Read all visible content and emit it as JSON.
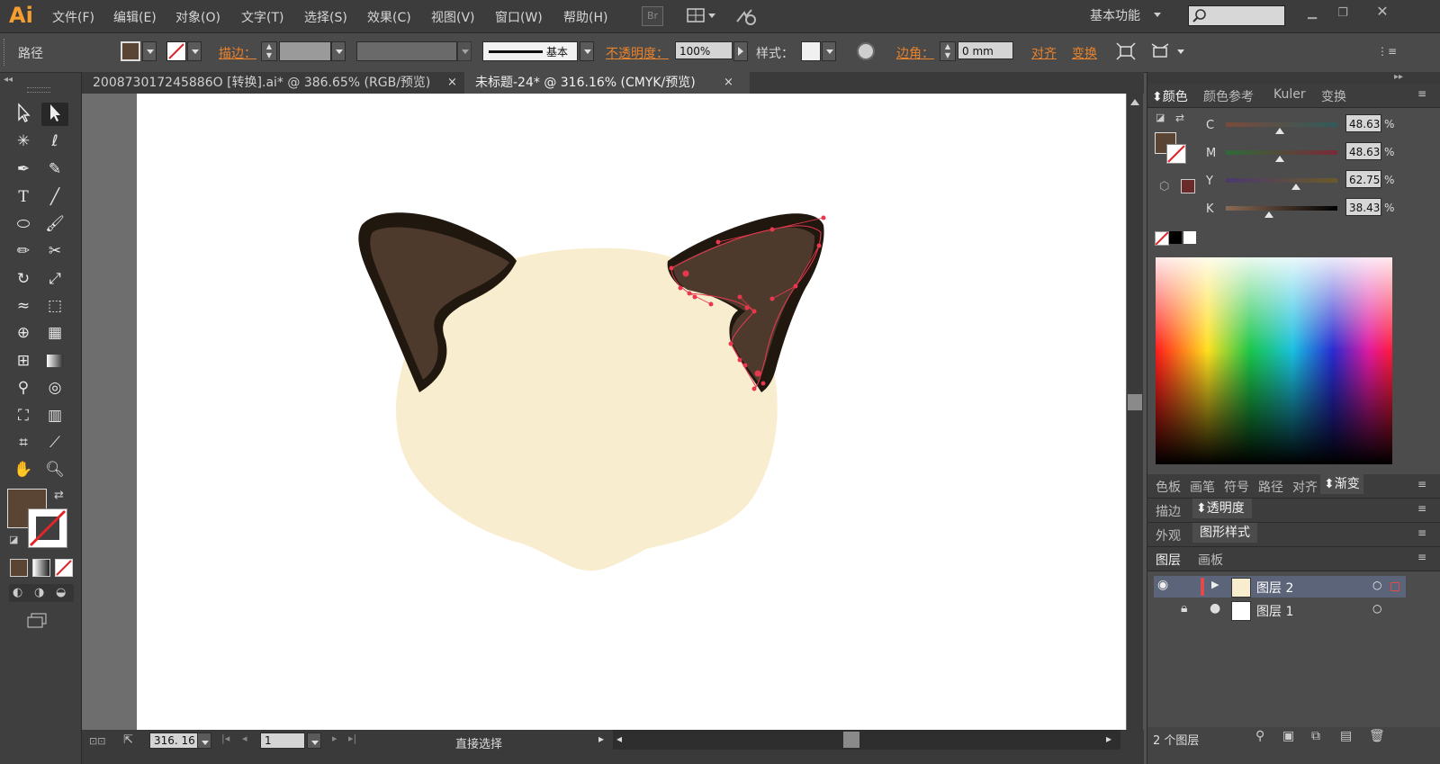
{
  "app": {
    "logo": "Ai",
    "workspace": "基本功能",
    "bridge_label": "Br"
  },
  "menu": [
    "文件(F)",
    "编辑(E)",
    "对象(O)",
    "文字(T)",
    "选择(S)",
    "效果(C)",
    "视图(V)",
    "窗口(W)",
    "帮助(H)"
  ],
  "controlbar": {
    "object_type": "路径",
    "stroke_label": "描边：",
    "stroke_style": "基本",
    "opacity_label": "不透明度：",
    "opacity_value": "100%",
    "style_label": "样式：",
    "corner_label": "边角：",
    "corner_value": "0 mm",
    "align_label": "对齐",
    "transform_label": "变换"
  },
  "tabs": [
    {
      "label": "200873017245886O [转换].ai* @ 386.65% (RGB/预览)",
      "active": false
    },
    {
      "label": "未标题-24* @ 316.16% (CMYK/预览)",
      "active": true
    }
  ],
  "colors": {
    "fill": "#5a4535",
    "ear_outer": "#20170f",
    "ear_inner": "#4e3a2c",
    "face": "#f8edcf",
    "accent": "#e8832e",
    "path_selection": "#e8384f"
  },
  "statusbar": {
    "zoom": "316. 16",
    "artboard_num": "1",
    "tool_name": "直接选择"
  },
  "color_panel": {
    "tabs": [
      "颜色",
      "颜色参考",
      "Kuler",
      "变换"
    ],
    "channels": [
      {
        "label": "C",
        "value": "48.63",
        "fraction": 0.4863
      },
      {
        "label": "M",
        "value": "48.63",
        "fraction": 0.4863
      },
      {
        "label": "Y",
        "value": "62.75",
        "fraction": 0.6275
      },
      {
        "label": "K",
        "value": "38.43",
        "fraction": 0.3843
      }
    ],
    "percent": "%"
  },
  "panel_groups": {
    "row1": [
      "色板",
      "画笔",
      "符号",
      "路径",
      "对齐",
      "渐变"
    ],
    "row2": [
      "描边",
      "透明度"
    ],
    "row3": [
      "外观",
      "图形样式"
    ],
    "row4": [
      "图层",
      "画板"
    ]
  },
  "layers": [
    {
      "name": "图层 2",
      "expanded": true,
      "selected": true
    },
    {
      "name": "图层 1",
      "expanded": false,
      "selected": false
    }
  ],
  "layers_footer": "2 个图层"
}
